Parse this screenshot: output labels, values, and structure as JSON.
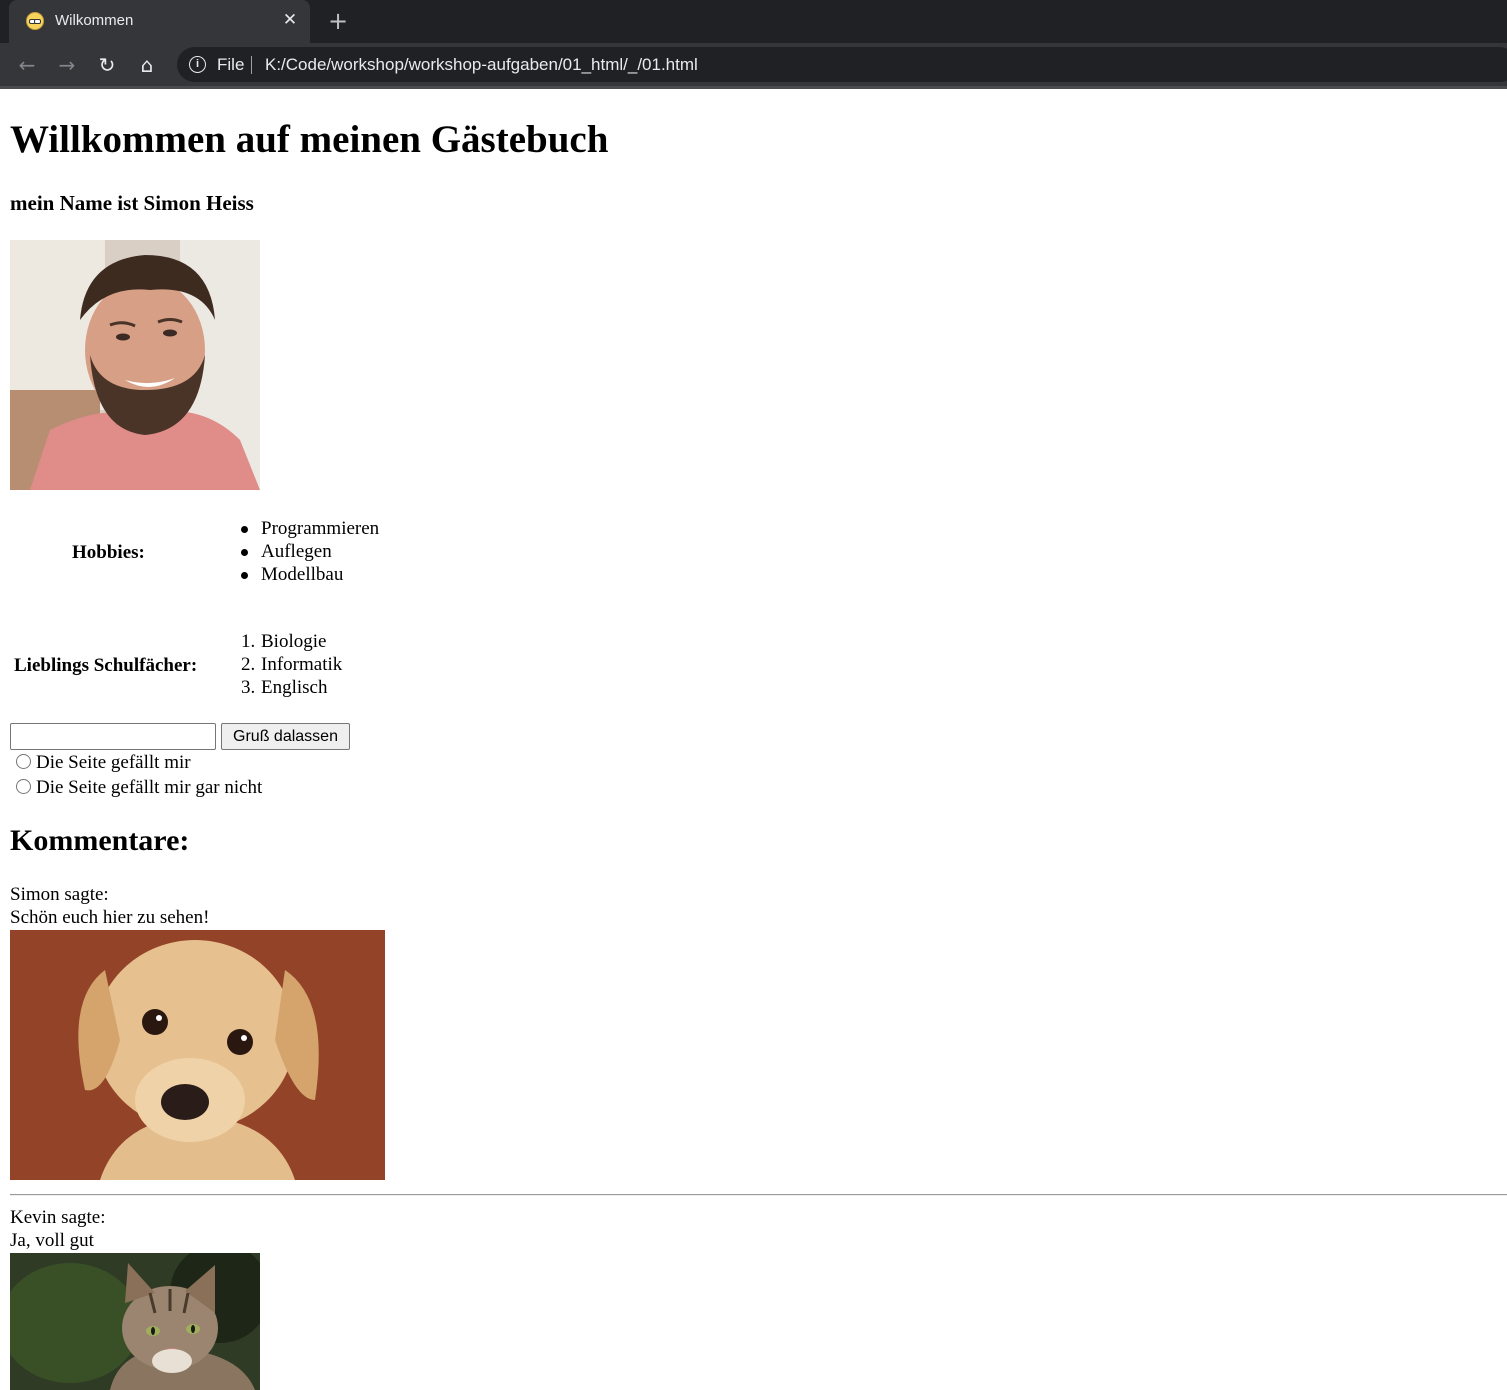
{
  "browser": {
    "tab_title": "Wilkommen",
    "tab_close": "✕",
    "new_tab": "+",
    "back": "←",
    "forward": "→",
    "reload": "↻",
    "home": "⌂",
    "info": "i",
    "scheme": "File",
    "url": "K:/Code/workshop/workshop-aufgaben/01_html/_/01.html",
    "favicon": "emoji-face-icon"
  },
  "page": {
    "title": "Willkommen auf meinen Gästebuch",
    "subtitle": "mein Name ist Simon Heiss",
    "hobbies_label": "Hobbies:",
    "hobbies": [
      "Programmieren",
      "Auflegen",
      "Modellbau"
    ],
    "subjects_label": "Lieblings Schulfächer:",
    "subjects": [
      "Biologie",
      "Informatik",
      "Englisch"
    ],
    "subject_numbers": [
      "1.",
      "2.",
      "3."
    ],
    "greeting_input_value": "",
    "greeting_button": "Gruß dalassen",
    "radio_options": [
      "Die Seite gefällt mir",
      "Die Seite gefällt mir gar nicht"
    ],
    "comments_heading": "Kommentare:",
    "comments": [
      {
        "author_line": "Simon sagte:",
        "text": "Schön euch hier zu sehen!",
        "image": "dog-photo"
      },
      {
        "author_line": "Kevin sagte:",
        "text": "Ja, voll gut",
        "image": "cat-photo"
      }
    ]
  },
  "colors": {
    "tabbar_bg": "#202124",
    "tab_bg": "#35363a",
    "omnibox_bg": "#202124",
    "page_bg": "#ffffff"
  }
}
